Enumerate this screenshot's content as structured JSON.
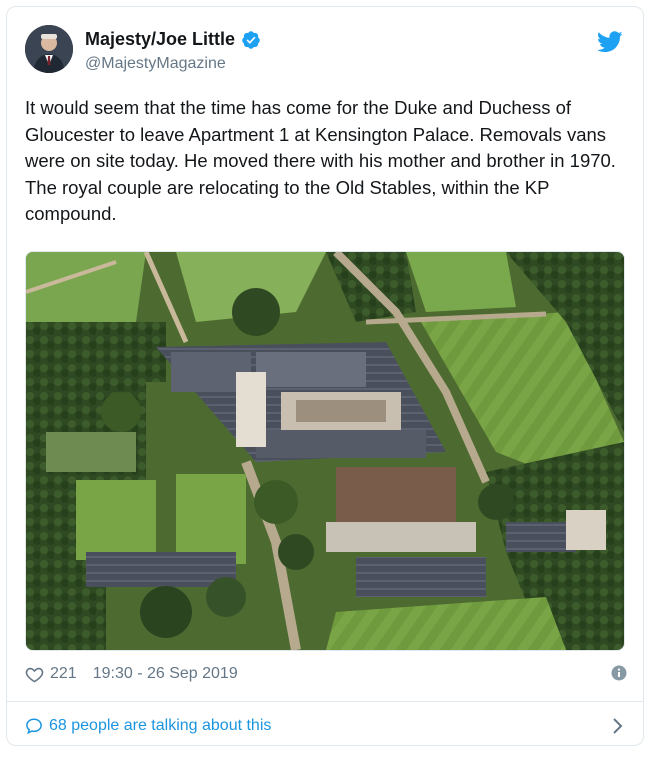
{
  "tweet": {
    "author": {
      "display_name": "Majesty/Joe Little",
      "handle": "@MajestyMagazine",
      "verified": true
    },
    "text": "It would seem that the time has come for the Duke and Duchess of Gloucester to leave Apartment 1 at Kensington Palace. Removals vans were on site today. He moved there with his mother and brother in 1970. The royal couple are relocating to the Old Stables, within the KP compound.",
    "media": {
      "icon": "aerial-photo",
      "description_visible": false
    },
    "likes": "221",
    "timestamp": "19:30 - 26 Sep 2019",
    "talking": "68 people are talking about this"
  },
  "icons": {
    "logo": "twitter-bird-icon",
    "verified": "verified-badge-icon",
    "like": "heart-icon",
    "info": "info-icon",
    "reply": "speech-bubble-icon",
    "more": "chevron-right-icon"
  },
  "colors": {
    "brand": "#1da1f2",
    "link": "#1b95e0",
    "muted": "#657786",
    "text": "#14171a"
  }
}
